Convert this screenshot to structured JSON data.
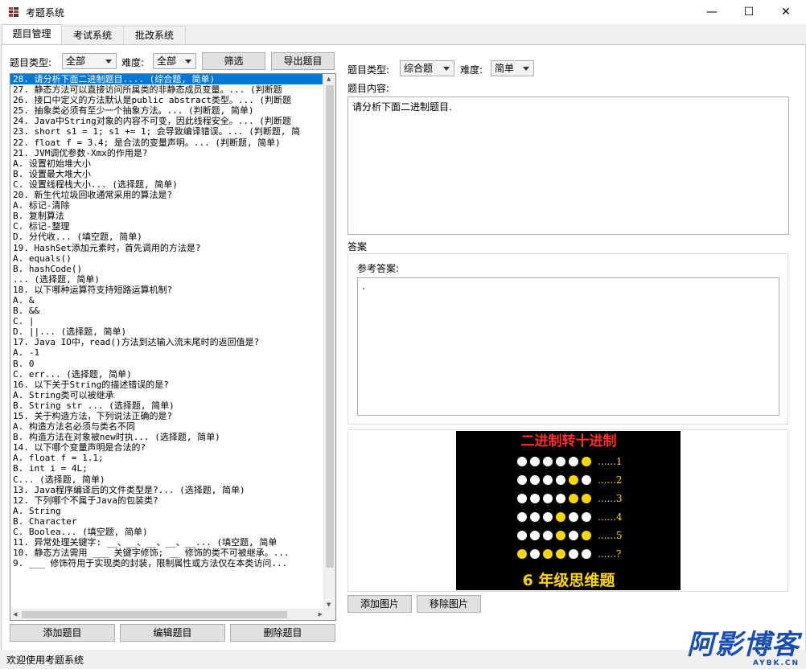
{
  "window": {
    "title": "考题系统",
    "controls": {
      "minimize": "—",
      "maximize": "☐",
      "close": "✕"
    }
  },
  "tabs": [
    {
      "label": "题目管理",
      "active": true
    },
    {
      "label": "考试系统",
      "active": false
    },
    {
      "label": "批改系统",
      "active": false
    }
  ],
  "filter": {
    "type_label": "题目类型:",
    "type_value": "全部",
    "difficulty_label": "难度:",
    "difficulty_value": "全部",
    "filter_button": "筛选",
    "export_button": "导出题目"
  },
  "question_list": [
    "28. 请分析下面二进制题目.... (综合题, 简单)",
    "27. 静态方法可以直接访问所属类的非静态成员变量。... (判断题",
    "26. 接口中定义的方法默认是public abstract类型。... (判断题",
    "25. 抽象类必须有至少一个抽象方法。... (判断题, 简单)",
    "24. Java中String对象的内容不可变，因此线程安全。... (判断题",
    "23. short s1 = 1; s1 += 1; 会导致编译错误。... (判断题, 简",
    "22. float f = 3.4; 是合法的变量声明。... (判断题, 简单)",
    "21. JVM调优参数-Xmx的作用是?",
    "A. 设置初始堆大小",
    "B. 设置最大堆大小",
    "C. 设置线程栈大小... (选择题, 简单)",
    "20. 新生代垃圾回收通常采用的算法是?",
    "A. 标记-清除",
    "B. 复制算法",
    "C. 标记-整理",
    "D. 分代收... (填空题, 简单)",
    "19. HashSet添加元素时，首先调用的方法是?",
    "A. equals()",
    "B. hashCode()",
    "... (选择题, 简单)",
    "18. 以下哪种运算符支持短路运算机制?",
    "A. &",
    "B. &&",
    "C. |",
    "D. ||... (选择题, 简单)",
    "17. Java IO中，read()方法到达输入流末尾时的返回值是?",
    "A. -1",
    "B. 0",
    "C. err... (选择题, 简单)",
    "16. 以下关于String的描述错误的是?",
    "A. String类可以被继承",
    "B. String str ... (选择题, 简单)",
    "15. 关于构造方法，下列说法正确的是?",
    "A. 构造方法名必须与类名不同",
    "B. 构造方法在对象被new时执... (选择题, 简单)",
    "14. 以下哪个变量声明是合法的?",
    "A. float f = 1.1;",
    "B. int i = 4L;",
    "C... (选择题, 简单)",
    "13. Java程序编译后的文件类型是?... (选择题, 简单)",
    "12. 下列哪个不属于Java的包装类?",
    "A. String",
    "B. Character",
    "C. Boolea... (填空题, 简单)",
    "11. 异常处理关键字: __、__、__、__、__... (填空题, 简单",
    "10. 静态方法需用 ___ 关键字修饰; __ 修饰的类不可被继承。...",
    "9. ___ 修饰符用于实现类的封装，限制属性或方法仅在本类访问..."
  ],
  "list_buttons": {
    "add": "添加题目",
    "edit": "编辑题目",
    "delete": "删除题目"
  },
  "editor": {
    "type_label": "题目类型:",
    "type_value": "综合题",
    "difficulty_label": "难度:",
    "difficulty_value": "简单",
    "content_label": "题目内容:",
    "content_value": "请分析下面二进制题目.",
    "answer_group_label": "答案",
    "ref_answer_label": "参考答案:",
    "ref_answer_value": "."
  },
  "image": {
    "title": "二进制转十进制",
    "footer": "6 年级思维题",
    "rows": [
      {
        "pattern": [
          0,
          0,
          0,
          0,
          0,
          1
        ],
        "label": "......1"
      },
      {
        "pattern": [
          0,
          0,
          0,
          0,
          1,
          0
        ],
        "label": "......2"
      },
      {
        "pattern": [
          0,
          0,
          0,
          0,
          1,
          1
        ],
        "label": "......3"
      },
      {
        "pattern": [
          0,
          0,
          0,
          1,
          0,
          0
        ],
        "label": "......4"
      },
      {
        "pattern": [
          0,
          0,
          0,
          1,
          0,
          1
        ],
        "label": "......5"
      },
      {
        "pattern": [
          1,
          0,
          1,
          1,
          0,
          0
        ],
        "label": "......?"
      }
    ],
    "colors": {
      "bg": "#000000",
      "white": "#ffffff",
      "yellow": "#ffd700",
      "title": "#ff3030",
      "footer": "#ffd700"
    }
  },
  "image_buttons": {
    "add": "添加图片",
    "remove": "移除图片"
  },
  "status": {
    "text": "欢迎使用考题系统"
  },
  "watermark": {
    "main": "阿影博客",
    "sub": "AYBK.CN"
  },
  "colors": {
    "selection": "#0078d7"
  }
}
